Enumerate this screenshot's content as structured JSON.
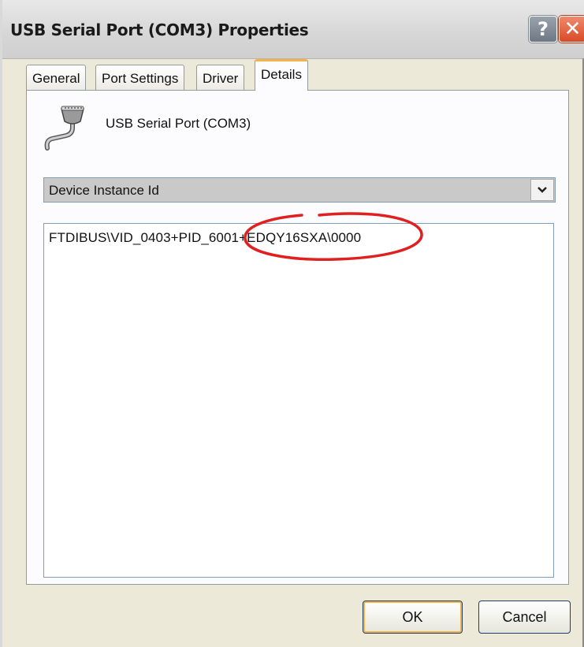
{
  "window": {
    "title": "USB Serial Port (COM3) Properties",
    "help_label": "?",
    "close_label": "✕"
  },
  "tabs": [
    {
      "label": "General",
      "active": false
    },
    {
      "label": "Port Settings",
      "active": false
    },
    {
      "label": "Driver",
      "active": false
    },
    {
      "label": "Details",
      "active": true
    }
  ],
  "details": {
    "device_icon": "serial-port-icon",
    "device_name": "USB Serial Port (COM3)",
    "property_select": {
      "value": "Device Instance Id"
    },
    "property_value": "FTDIBUS\\VID_0403+PID_6001+EDQY16SXA\\0000",
    "annotation": {
      "shape": "ellipse",
      "color": "#e02020",
      "target": "+EDQY16SXA\\"
    }
  },
  "buttons": {
    "ok": "OK",
    "cancel": "Cancel"
  },
  "colors": {
    "active_tab_accent": "#f5b445",
    "close_button": "#d94a26"
  }
}
